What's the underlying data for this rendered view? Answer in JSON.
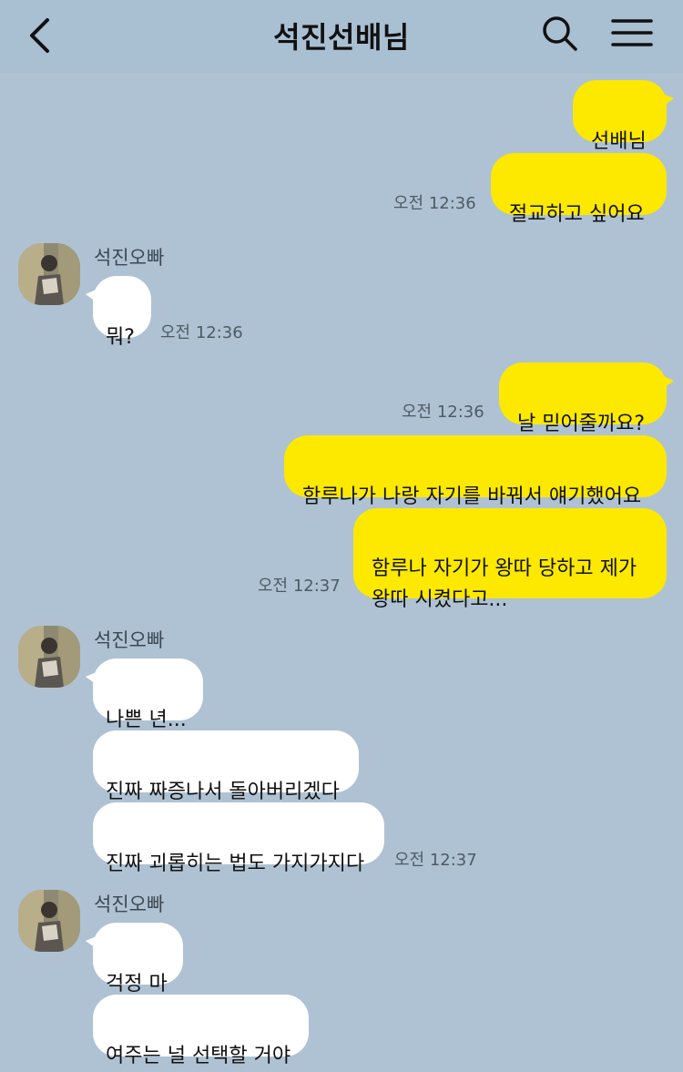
{
  "header": {
    "title": "석진선배님",
    "back_icon": "chevron-left-icon",
    "search_icon": "search-icon",
    "menu_icon": "hamburger-menu-icon"
  },
  "colors": {
    "background": "#aec2d3",
    "my_bubble": "#fde800",
    "other_bubble": "#ffffff"
  },
  "messages": {
    "m1": "선배님",
    "m2": "절교하고 싶어요",
    "t1": "오전 12:36",
    "sender1": "석진오빠",
    "m3": "뭐?",
    "t2": "오전 12:36",
    "m4": "날 믿어줄까요?",
    "t3": "오전 12:36",
    "m5": "함루나가 나랑 자기를 바꿔서 얘기했어요",
    "m6": "함루나 자기가 왕따 당하고 제가\n왕따 시켰다고...",
    "t4": "오전 12:37",
    "sender2": "석진오빠",
    "m7": "나쁜 년...",
    "m8": "진짜 짜증나서 돌아버리겠다",
    "m9": "진짜 괴롭히는 법도 가지가지다",
    "t5": "오전 12:37",
    "sender3": "석진오빠",
    "m10": "걱정 마",
    "m11": "여주는 널 선택할 거야"
  }
}
